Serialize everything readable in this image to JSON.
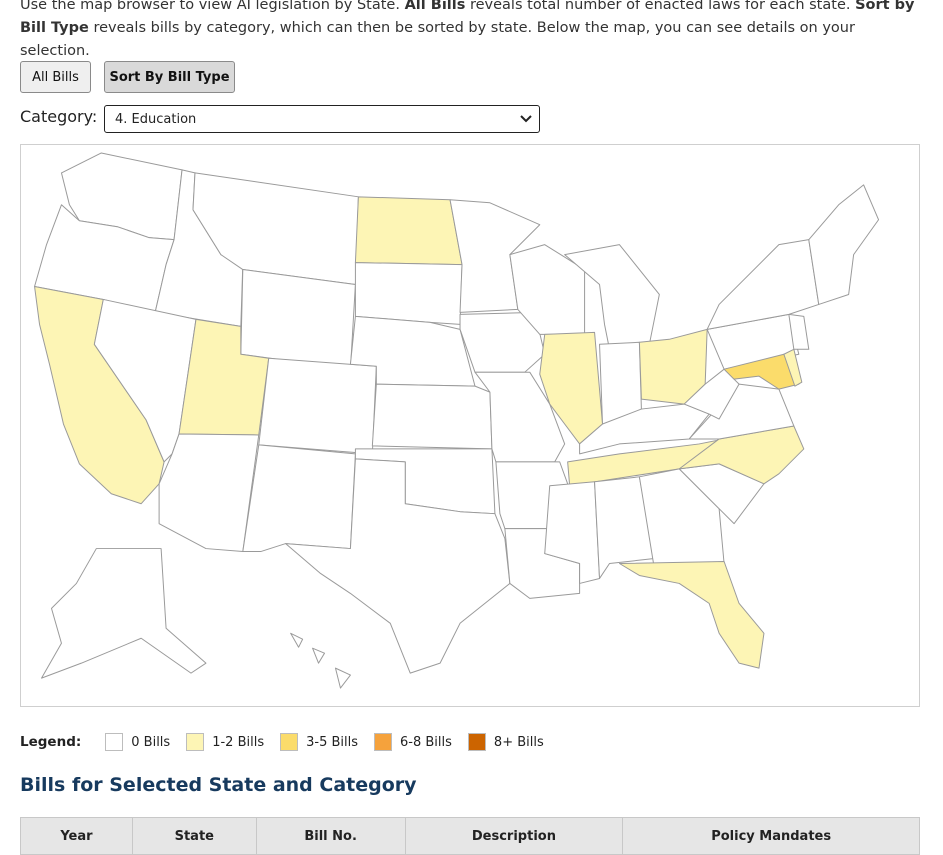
{
  "intro": {
    "p1": "Use the map browser to view AI legislation by State. ",
    "b1": "All Bills",
    "p2": " reveals total number of enacted laws for each state. ",
    "b2": "Sort by Bill Type",
    "p3": " reveals bills by category, which can then be sorted by state. Below the map, you can see details on your selection."
  },
  "buttons": {
    "all_bills": "All Bills",
    "sort_by_type": "Sort By Bill Type"
  },
  "category": {
    "label": "Category:",
    "selected": "4. Education"
  },
  "colors": {
    "none": "#ffffff",
    "low": "#fdf5b5",
    "mid": "#fbdc6b",
    "high": "#f5a23c",
    "max": "#cc6400",
    "border": "#9a9a9a"
  },
  "highlighted_states": {
    "1-2 Bills": [
      "California",
      "Utah",
      "North Dakota",
      "Illinois",
      "Ohio",
      "Tennessee",
      "North Carolina",
      "Florida",
      "Delaware"
    ],
    "3-5 Bills": [
      "Maryland"
    ]
  },
  "legend": {
    "title": "Legend:",
    "items": [
      "0 Bills",
      "1-2 Bills",
      "3-5 Bills",
      "6-8 Bills",
      "8+ Bills"
    ]
  },
  "section": {
    "title": "Bills for Selected State and Category"
  },
  "table": {
    "headers": [
      "Year",
      "State",
      "Bill No.",
      "Description",
      "Policy Mandates"
    ]
  }
}
